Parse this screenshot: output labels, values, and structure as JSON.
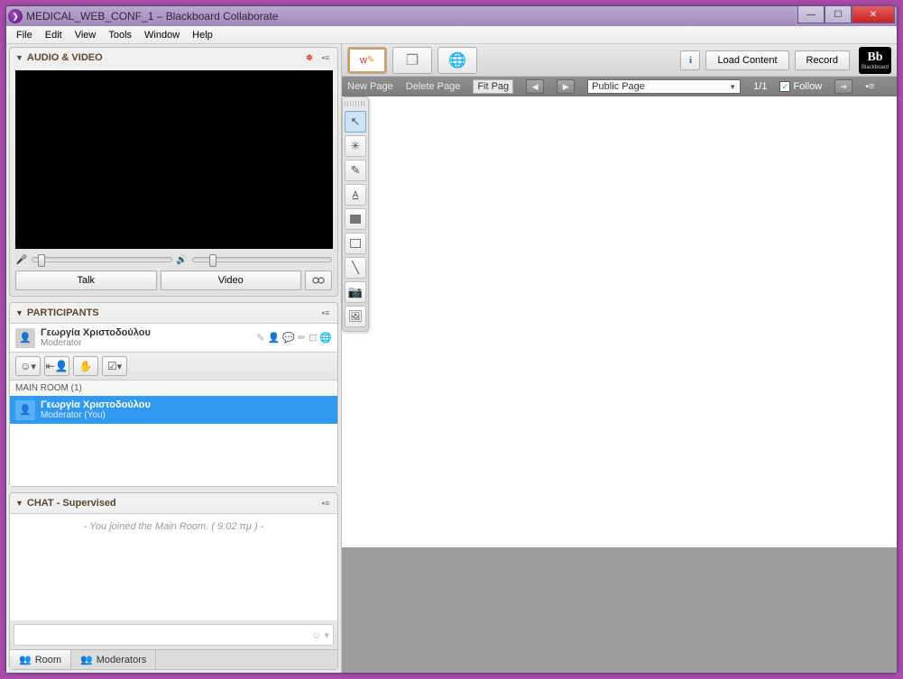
{
  "window": {
    "title": "MEDICAL_WEB_CONF_1 – Blackboard Collaborate"
  },
  "menu": {
    "file": "File",
    "edit": "Edit",
    "view": "View",
    "tools": "Tools",
    "window": "Window",
    "help": "Help"
  },
  "av": {
    "title": "AUDIO & VIDEO",
    "talk": "Talk",
    "video": "Video"
  },
  "participants": {
    "title": "PARTICIPANTS",
    "self_name": "Γεωργία Χριστοδούλου",
    "self_role": "Moderator",
    "room_label": "MAIN ROOM (1)",
    "room_user_name": "Γεωργία Χριστοδούλου",
    "room_user_role": "Moderator (You)"
  },
  "chat": {
    "title": "CHAT - Supervised",
    "joined_msg": "- You joined the Main Room. ( 9:02 πμ ) -",
    "tab_room": "Room",
    "tab_mods": "Moderators"
  },
  "wb": {
    "load": "Load Content",
    "record": "Record",
    "brand_sub": "Blackboard",
    "newpage": "New Page",
    "delpage": "Delete Page",
    "fitpage": "Fit Pag",
    "page_sel": "Public Page",
    "pagenum": "1/1",
    "follow": "Follow"
  }
}
